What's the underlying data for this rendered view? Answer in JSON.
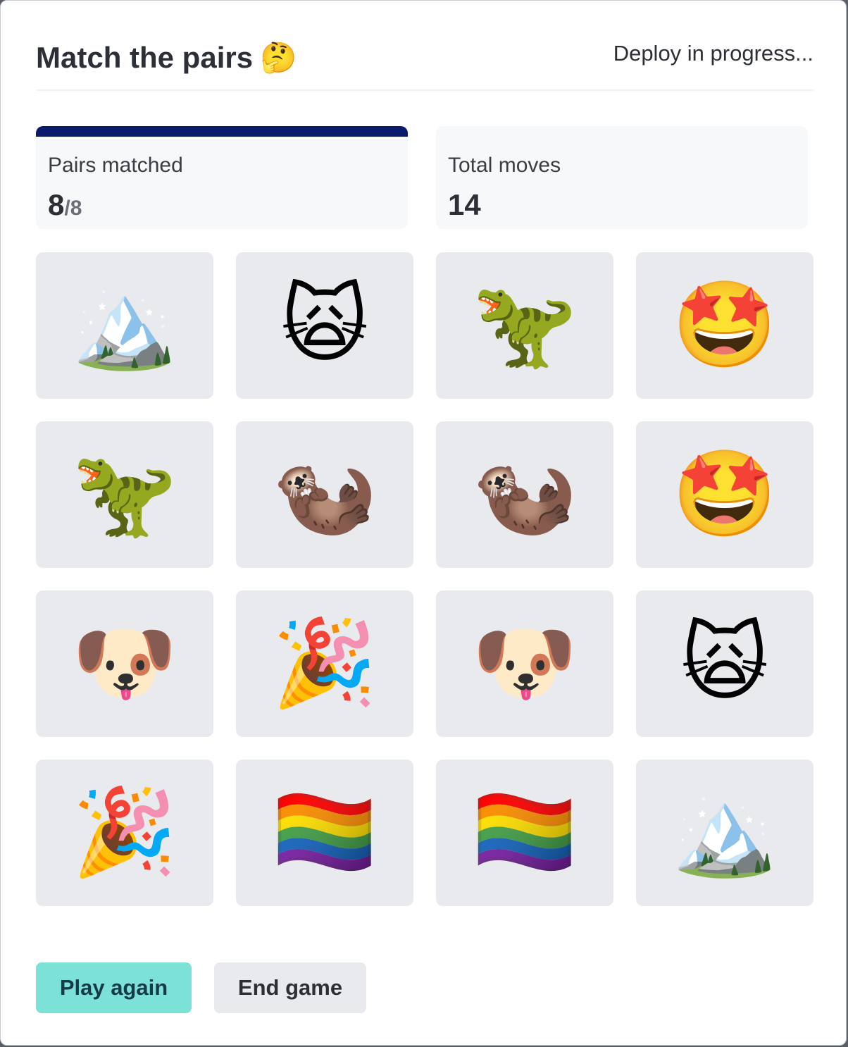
{
  "header": {
    "title": "Match the pairs",
    "title_emoji": "🤔",
    "status": "Deploy in progress..."
  },
  "stats": {
    "pairs": {
      "label": "Pairs matched",
      "value": "8",
      "denominator": "/8",
      "progress_fraction": 1.0
    },
    "moves": {
      "label": "Total moves",
      "value": "14"
    }
  },
  "board": {
    "columns": 4,
    "cards": [
      {
        "emoji": "🏔️",
        "icon": "mountain-icon"
      },
      {
        "emoji": "🙀",
        "icon": "weary-cat-icon"
      },
      {
        "emoji": "🦖",
        "icon": "t-rex-icon"
      },
      {
        "emoji": "🤩",
        "icon": "star-struck-icon"
      },
      {
        "emoji": "🦖",
        "icon": "t-rex-icon"
      },
      {
        "emoji": "🦦",
        "icon": "otter-icon"
      },
      {
        "emoji": "🦦",
        "icon": "otter-icon"
      },
      {
        "emoji": "🤩",
        "icon": "star-struck-icon"
      },
      {
        "emoji": "🐶",
        "icon": "dog-icon"
      },
      {
        "emoji": "🎉",
        "icon": "party-popper-icon"
      },
      {
        "emoji": "🐶",
        "icon": "dog-icon"
      },
      {
        "emoji": "🙀",
        "icon": "weary-cat-icon"
      },
      {
        "emoji": "🎉",
        "icon": "party-popper-icon"
      },
      {
        "emoji": "🏳️‍🌈",
        "icon": "rainbow-flag-icon"
      },
      {
        "emoji": "🏳️‍🌈",
        "icon": "rainbow-flag-icon"
      },
      {
        "emoji": "🏔️",
        "icon": "mountain-icon"
      }
    ]
  },
  "actions": {
    "play_again": "Play again",
    "end_game": "End game"
  },
  "colors": {
    "progress": "#0b1b6b",
    "primary_button": "#7ce2d8",
    "card_bg": "#e8eaee"
  }
}
